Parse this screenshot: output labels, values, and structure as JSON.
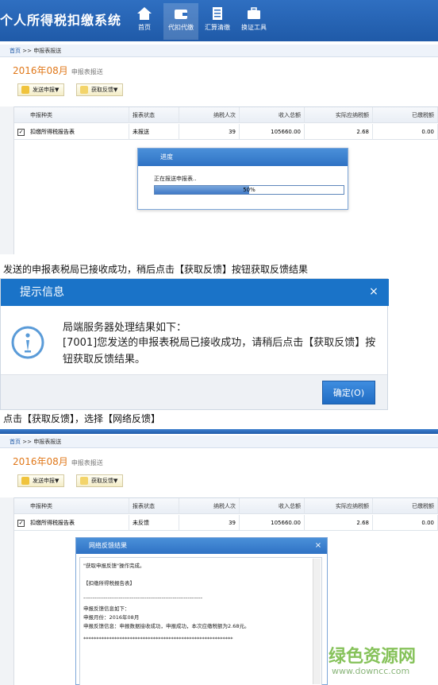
{
  "app": {
    "title": "个人所得税扣缴系统",
    "nav": [
      {
        "label": "首页"
      },
      {
        "label": "代扣代缴"
      },
      {
        "label": "汇算清缴"
      },
      {
        "label": "换证工具"
      }
    ]
  },
  "breadcrumb": {
    "home": "首页",
    "sep": ">>",
    "current": "申报表报送"
  },
  "period": {
    "value": "2016年08月",
    "label": "申报表报送"
  },
  "toolbar": {
    "send_label": "发送申报▼",
    "feedback_label": "获取反馈▼"
  },
  "table": {
    "headers": [
      "申报种类",
      "报表状态",
      "纳税人次",
      "收入总额",
      "实际应纳税额",
      "已缴税额"
    ],
    "row1": {
      "checked": "✓",
      "type": "扣缴所得税报告表",
      "status": "未报送",
      "count": "39",
      "income": "105660.00",
      "tax": "2.68",
      "paid": "0.00"
    },
    "row2": {
      "checked": "✓",
      "type": "扣缴所得税报告表",
      "status": "未反馈",
      "count": "39",
      "income": "105660.00",
      "tax": "2.68",
      "paid": "0.00"
    }
  },
  "progress": {
    "title": "进度",
    "message": "正在报送申报表..",
    "percent": 50,
    "percent_text": "50%"
  },
  "captions": {
    "c1": "发送的申报表税局已接收成功，稍后点击【获取反馈】按钮获取反馈结果",
    "c2": "点击【获取反馈】，选择【网络反馈】"
  },
  "prompt": {
    "title": "提示信息",
    "close": "×",
    "heading": "局端服务器处理结果如下：",
    "message": "[7001]您发送的申报表税局已接收成功，请稍后点击【获取反馈】按钮获取反馈结果。",
    "ok_label": "确定(O)"
  },
  "feedback": {
    "title": "网络反馈结果",
    "close": "×",
    "lines": [
      "\"获取申报反馈\"操作完成。",
      "【扣缴所得税报告表】",
      "----------------------------------------------------------------",
      "申报反馈信息如下：",
      "申报月份：2016年08月",
      "申报反馈信息：申报数据接收成功，申报成功，本次应缴税额为2.68元。",
      "**********************************************************"
    ]
  },
  "watermark": {
    "main": "绿色资源网",
    "url": "www.downcc.com"
  },
  "colors": {
    "header_blue": "#1f5aa8",
    "dialog_blue": "#1a73c8",
    "period_orange": "#e0781a",
    "watermark_green": "#86c25a"
  },
  "icons": [
    "home-icon",
    "wallet-icon",
    "document-icon",
    "toolbox-icon",
    "info-icon",
    "close-icon",
    "send-icon",
    "feedback-icon"
  ]
}
